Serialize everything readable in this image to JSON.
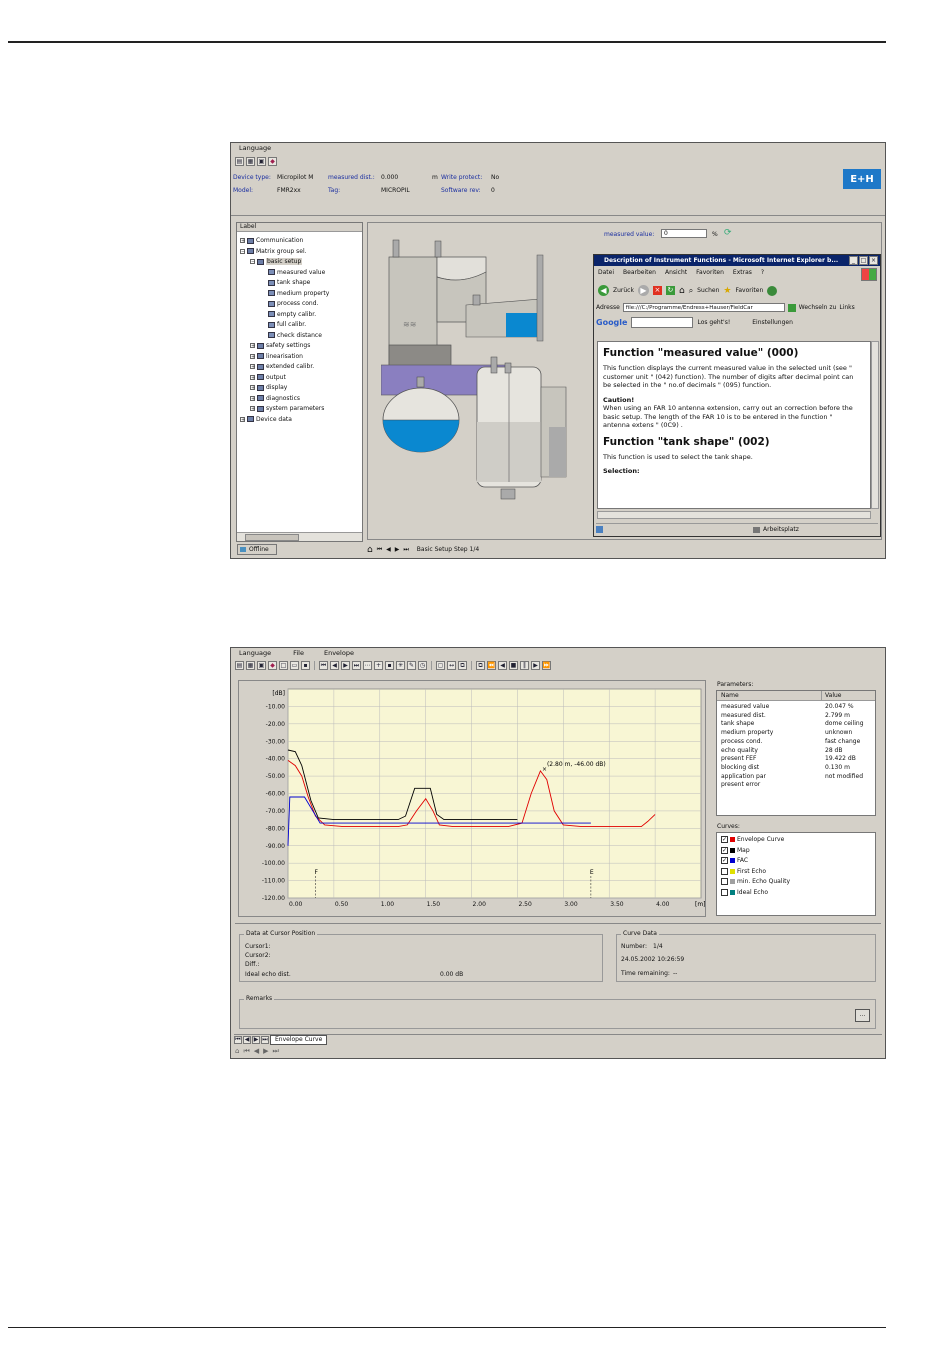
{
  "win1": {
    "menu": [
      "Language"
    ],
    "device_type_label": "Device type:",
    "device_type_value": "Micropilot M",
    "measured_dist_label": "measured dist.:",
    "measured_dist_value": "0.000",
    "measured_dist_unit": "m",
    "write_protect_label": "Write protect:",
    "write_protect_value": "No",
    "model_label": "Model:",
    "model_value": "FMR2xx",
    "tag_label": "Tag:",
    "tag_value": "MICROPIL",
    "software_rev_label": "Software rev:",
    "software_rev_value": "0",
    "logo": "E+H",
    "tree_header": "Label",
    "tree": [
      "Communication",
      "Matrix group sel.",
      "basic setup",
      "measured value",
      "tank shape",
      "medium property",
      "process cond.",
      "empty calibr.",
      "full calibr.",
      "check distance",
      "safety settings",
      "linearisation",
      "extended calibr.",
      "output",
      "display",
      "diagnostics",
      "system parameters",
      "Device data"
    ],
    "offline_tab": "Offline",
    "measured_value_label": "measured value:",
    "measured_value_value": "0",
    "measured_value_unit": "%",
    "status_text": "Basic Setup Step 1/4",
    "ie": {
      "title": "Description of Instrument Functions - Microsoft Internet Explorer b...",
      "menu": [
        "Datei",
        "Bearbeiten",
        "Ansicht",
        "Favoriten",
        "Extras",
        "?"
      ],
      "back": "Zurück",
      "search": "Suchen",
      "favorites": "Favoriten",
      "address_label": "Adresse",
      "address": "file:///C:/Programme/Endress+Hauser/FieldCar",
      "go": "Wechseln zu",
      "links": "Links",
      "google": "Google",
      "los": "Los geht's!",
      "settings": "Einstellungen",
      "h1": "Function \"measured value\" (000)",
      "p1": "This function displays the current measured value in the selected unit (see \" customer unit \" (042) function). The number of digits after decimal point can be selected in the \" no.of decimals \" (095) function.",
      "caution": "Caution!",
      "p2": "When using an FAR 10 antenna extension, carry out an correction before the basic setup. The length of the FAR 10 is to be entered in the function \" antenna extens \" (0C9) .",
      "h2": "Function \"tank shape\" (002)",
      "p3": "This function is used to select the tank shape.",
      "selection": "Selection:",
      "status_zone": "Arbeitsplatz"
    }
  },
  "win2": {
    "menu": [
      "Language",
      "File",
      "Envelope"
    ],
    "params_title": "Parameters:",
    "params_headers": [
      "Name",
      "Value"
    ],
    "params": [
      {
        "name": "measured value",
        "value": "20.047  %"
      },
      {
        "name": "measured dist.",
        "value": "2.799  m"
      },
      {
        "name": "tank shape",
        "value": "dome ceiling"
      },
      {
        "name": "medium property",
        "value": "unknown"
      },
      {
        "name": "process cond.",
        "value": "fast change"
      },
      {
        "name": "echo quality",
        "value": "28  dB"
      },
      {
        "name": "present FEF",
        "value": "19.422  dB"
      },
      {
        "name": "blocking dist",
        "value": "0.130  m"
      },
      {
        "name": "application par",
        "value": "not modified"
      },
      {
        "name": "present error",
        "value": ""
      }
    ],
    "curves_title": "Curves:",
    "curves": [
      {
        "name": "Envelope Curve",
        "checked": true,
        "color": "#e00000"
      },
      {
        "name": "Map",
        "checked": true,
        "color": "#000000"
      },
      {
        "name": "FAC",
        "checked": true,
        "color": "#0000d0"
      },
      {
        "name": "First Echo",
        "checked": false,
        "color": "#e0e000"
      },
      {
        "name": "min. Echo Quality",
        "checked": false,
        "color": "#a0a0a0"
      },
      {
        "name": "Ideal Echo",
        "checked": false,
        "color": "#008080"
      }
    ],
    "cursor_title": "Data at Cursor Position",
    "cursor1": "Cursor1:",
    "cursor2": "Cursor2:",
    "diff": "Diff.:",
    "ideal_label": "Ideal echo dist.",
    "ideal_value": "0.00 dB",
    "curve_data_title": "Curve Data",
    "number_label": "Number:",
    "number_value": "1/4",
    "date": "24.05.2002  10:26:59",
    "time_label": "Time remaining:",
    "time_value": "--",
    "remarks_title": "Remarks",
    "remarks_btn": "...",
    "tab": "Envelope Curve"
  },
  "chart_data": {
    "type": "line",
    "ylabel": "[dB]",
    "xlabel": "[m]",
    "xlim": [
      0,
      4.5
    ],
    "ylim": [
      -120,
      0
    ],
    "yticks": [
      "-10.00",
      "-20.00",
      "-30.00",
      "-40.00",
      "-50.00",
      "-60.00",
      "-70.00",
      "-80.00",
      "-90.00",
      "-100.00",
      "-110.00",
      "-120.00"
    ],
    "xticks": [
      "0.00",
      "0.50",
      "1.00",
      "1.50",
      "2.00",
      "2.50",
      "3.00",
      "3.50",
      "4.00"
    ],
    "annotation": "(2.80 m, -46.00 dB)",
    "markers": [
      {
        "label": "F",
        "x": 0.3
      },
      {
        "label": "E",
        "x": 3.3
      }
    ],
    "series": [
      {
        "name": "Envelope Curve",
        "color": "#e00000",
        "points": [
          [
            0,
            -41
          ],
          [
            0.08,
            -44
          ],
          [
            0.15,
            -50
          ],
          [
            0.22,
            -62
          ],
          [
            0.3,
            -73
          ],
          [
            0.4,
            -78
          ],
          [
            0.6,
            -79
          ],
          [
            0.9,
            -79
          ],
          [
            1.2,
            -79
          ],
          [
            1.3,
            -78
          ],
          [
            1.4,
            -70
          ],
          [
            1.5,
            -63
          ],
          [
            1.58,
            -70
          ],
          [
            1.65,
            -78
          ],
          [
            1.8,
            -79
          ],
          [
            2.1,
            -79
          ],
          [
            2.4,
            -79
          ],
          [
            2.55,
            -77
          ],
          [
            2.65,
            -60
          ],
          [
            2.75,
            -47
          ],
          [
            2.82,
            -52
          ],
          [
            2.9,
            -70
          ],
          [
            3.0,
            -78
          ],
          [
            3.2,
            -79
          ],
          [
            3.5,
            -79
          ],
          [
            3.85,
            -79
          ],
          [
            3.92,
            -76
          ],
          [
            4.0,
            -72
          ]
        ]
      },
      {
        "name": "Map",
        "color": "#000000",
        "points": [
          [
            0,
            -35
          ],
          [
            0.08,
            -36
          ],
          [
            0.15,
            -44
          ],
          [
            0.25,
            -64
          ],
          [
            0.33,
            -74
          ],
          [
            0.5,
            -75
          ],
          [
            1.2,
            -75
          ],
          [
            1.28,
            -73
          ],
          [
            1.38,
            -57
          ],
          [
            1.55,
            -57
          ],
          [
            1.62,
            -72
          ],
          [
            1.7,
            -75
          ],
          [
            2.5,
            -75
          ]
        ]
      },
      {
        "name": "FAC",
        "color": "#0000d0",
        "points": [
          [
            0,
            -90
          ],
          [
            0.02,
            -62
          ],
          [
            0.18,
            -62
          ],
          [
            0.35,
            -77
          ],
          [
            0.6,
            -77
          ],
          [
            3.3,
            -77
          ]
        ]
      }
    ]
  }
}
